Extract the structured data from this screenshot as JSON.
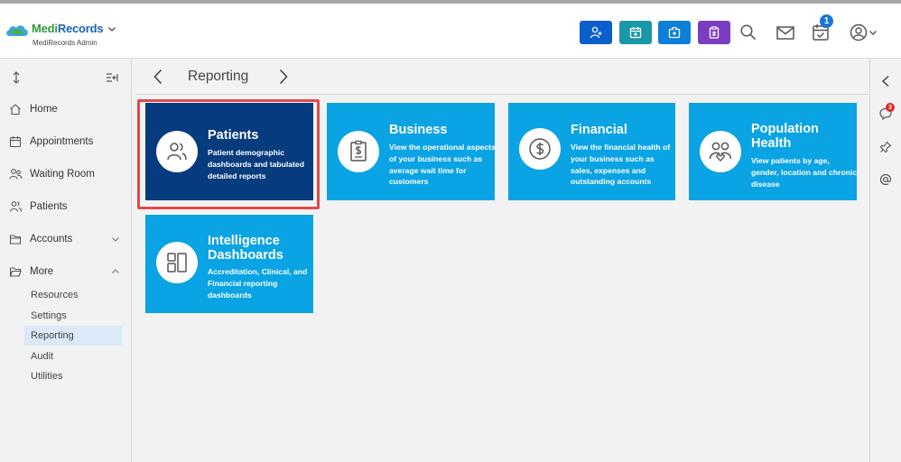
{
  "header": {
    "brand_medi": "Medi",
    "brand_records": "Records",
    "brand_sub": "MediRecords Admin",
    "notification_count": "1",
    "colors": {
      "add_patient": "#0b5fcc",
      "calendar": "#1a98a8",
      "medical": "#0c7fd9",
      "clipboard": "#7c3cc0"
    }
  },
  "sidebar": {
    "home": "Home",
    "appointments": "Appointments",
    "waiting_room": "Waiting Room",
    "patients": "Patients",
    "accounts": "Accounts",
    "more": "More",
    "sub": {
      "resources": "Resources",
      "settings": "Settings",
      "reporting": "Reporting",
      "audit": "Audit",
      "utilities": "Utilities"
    }
  },
  "rail": {
    "chat_badge": "3"
  },
  "breadcrumb": {
    "title": "Reporting"
  },
  "tiles": {
    "patients": {
      "title": "Patients",
      "desc": "Patient demographic dashboards and tabulated detailed reports"
    },
    "business": {
      "title": "Business",
      "desc": "View the operational aspects of your business such as average wait time for customers"
    },
    "financial": {
      "title": "Financial",
      "desc": "View the financial health of your business such as sales, expenses and outstanding accounts"
    },
    "population": {
      "title": "Population Health",
      "desc": "View patients by age, gender, location and chronic disease"
    },
    "intelligence": {
      "title": "Intelligence Dashboards",
      "desc": "Accreditation, Clinical, and Financial reporting dashboards"
    }
  }
}
